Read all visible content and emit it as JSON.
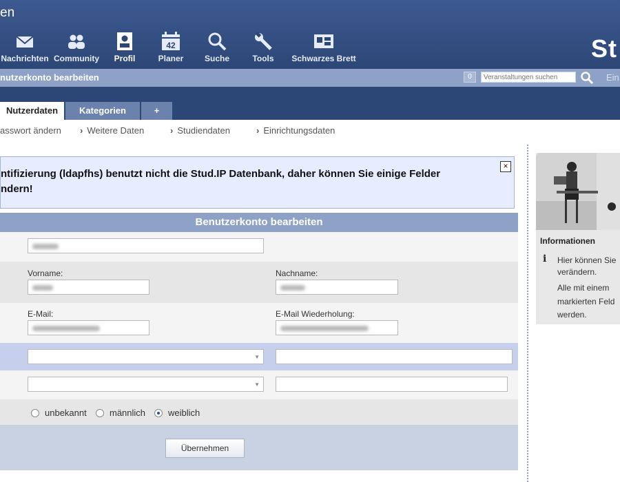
{
  "header": {
    "app_title": "en",
    "logo": "St",
    "nav": [
      {
        "label": "Nachrichten",
        "icon": "envelope-icon"
      },
      {
        "label": "Community",
        "icon": "people-icon"
      },
      {
        "label": "Profil",
        "icon": "profile-icon",
        "active": true
      },
      {
        "label": "Planer",
        "icon": "calendar-icon",
        "day": "42"
      },
      {
        "label": "Suche",
        "icon": "search-icon"
      },
      {
        "label": "Tools",
        "icon": "wrench-icon"
      },
      {
        "label": "Schwarzes Brett",
        "icon": "bulletin-board-icon"
      }
    ]
  },
  "subbar": {
    "title": "nutzerkonto bearbeiten",
    "course_count": "0",
    "search_placeholder": "Veranstaltungen suchen",
    "login": "Ein"
  },
  "tabs": [
    {
      "label": "Nutzerdaten",
      "active": true
    },
    {
      "label": "Kategorien"
    },
    {
      "label": "+"
    }
  ],
  "breadcrumbs": [
    "asswort ändern",
    "Weitere Daten",
    "Studiendaten",
    "Einrichtungsdaten"
  ],
  "notice": {
    "line1": "ntifizierung (ldapfhs) benutzt nicht die Stud.IP Datenbank, daher können Sie einige Felder",
    "line2": "ndern!",
    "close": "×"
  },
  "form": {
    "title": "Benutzerkonto bearbeiten",
    "firstname_label": "Vorname:",
    "lastname_label": "Nachname:",
    "email_label": "E-Mail:",
    "email_repeat_label": "E-Mail Wiederholung:",
    "gender_options": [
      "unbekannt",
      "männlich",
      "weiblich"
    ],
    "gender_selected": "weiblich",
    "submit": "Übernehmen"
  },
  "sidebar": {
    "title": "Informationen",
    "text_lines": [
      "Hier können Sie",
      "verändern.",
      "Alle mit einem",
      "markierten Feld",
      "werden."
    ]
  },
  "colors": {
    "header_dark": "#2c4676",
    "header_light": "#8da2c6",
    "notice_bg": "#e8ecff",
    "row_highlight": "#c6d0ec"
  }
}
